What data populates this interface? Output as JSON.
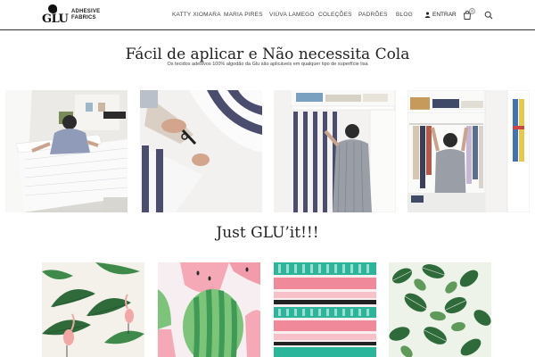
{
  "brand": {
    "logo_text": "GLU",
    "line1": "ADHESIVE",
    "line2": "FABRICS"
  },
  "nav": {
    "items": [
      {
        "label": "KATTY XIOMARA"
      },
      {
        "label": "MARIA PIRES"
      },
      {
        "label": "VIÚVA LAMEGO"
      },
      {
        "label": "COLEÇÕES"
      },
      {
        "label": "PADRÕES"
      },
      {
        "label": "BLOG"
      }
    ],
    "login_label": "ENTRAR",
    "cart_count": "0"
  },
  "hero": {
    "headline": "Fácil de aplicar e Não necessita  Cola",
    "subline": "Os tecidos adesivos 100% algodão da Glu são aplicáveis em qualquer tipo de superfície lisa"
  },
  "photos": [
    {
      "name": "photo-applying-wall"
    },
    {
      "name": "photo-cutting-fabric"
    },
    {
      "name": "photo-closet-striped"
    },
    {
      "name": "photo-wardrobe"
    }
  ],
  "section": {
    "title": "Just GLU’it!!!"
  },
  "fabrics": [
    {
      "name": "fabric-tropical-flamingo"
    },
    {
      "name": "fabric-watermelon"
    },
    {
      "name": "fabric-pink-teal-stripes"
    },
    {
      "name": "fabric-green-leaves"
    }
  ],
  "colors": {
    "text": "#222222",
    "stripe_dark": "#4a4d6e",
    "teal": "#2bb59a",
    "pink": "#f08a9a",
    "leaf_green": "#2f6b3a"
  },
  "icons": {
    "user": "user-icon",
    "cart": "cart-icon",
    "search": "search-icon"
  }
}
